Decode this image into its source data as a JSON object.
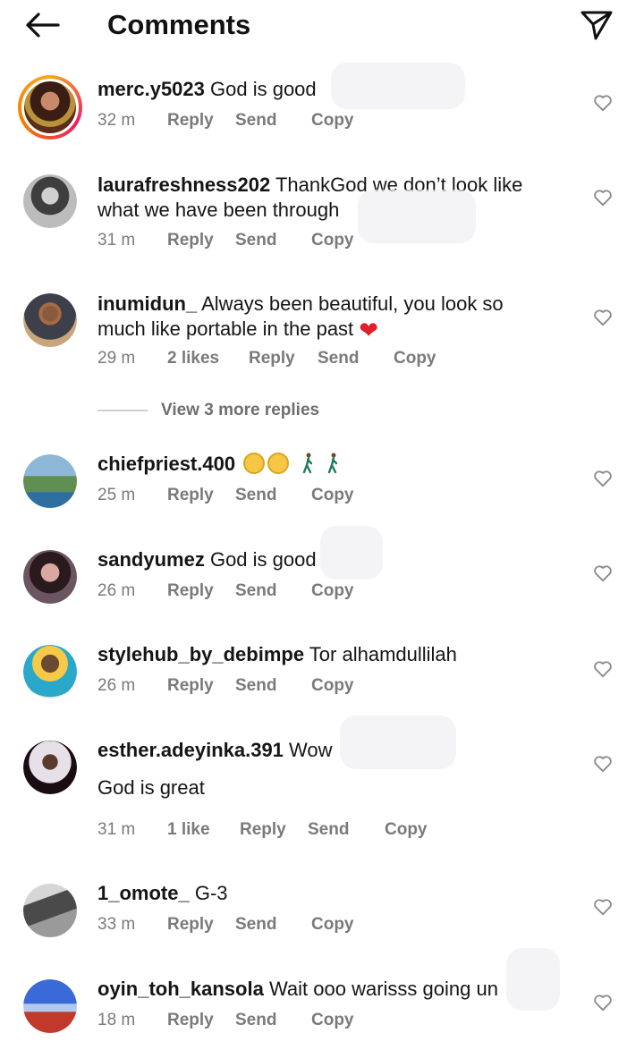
{
  "header": {
    "title": "Comments",
    "back_icon": "arrow-left-icon",
    "send_icon": "paper-plane-icon"
  },
  "colors": {
    "text": "#151515",
    "muted": "#7a7a7a",
    "heart_red": "#e01f2b",
    "story_ring": "#e91e63"
  },
  "actions": {
    "reply": "Reply",
    "send": "Send",
    "copy": "Copy"
  },
  "comments": [
    {
      "username": "merc.y5023",
      "text": "God is good",
      "time": "32 m",
      "likes": ""
    },
    {
      "username": "laurafreshness202",
      "text": "ThankGod we don’t look like what we have been through",
      "time": "31 m",
      "likes": ""
    },
    {
      "username": "inumidun_",
      "text": "Always been beautiful, you look so much like portable in the past",
      "time": "29 m",
      "likes": "2 likes"
    },
    {
      "username": "chiefpriest.400",
      "text": "",
      "time": "25 m",
      "likes": ""
    },
    {
      "username": "sandyumez",
      "text": "God is good",
      "time": "26 m",
      "likes": ""
    },
    {
      "username": "stylehub_by_debimpe",
      "text": "Tor alhamdullilah",
      "time": "26 m",
      "likes": ""
    },
    {
      "username": "esther.adeyinka.391",
      "text": "Wow",
      "text_line2": "God is great",
      "time": "31 m",
      "likes": "1 like"
    },
    {
      "username": "1_omote_",
      "text": "G-3",
      "time": "33 m",
      "likes": ""
    },
    {
      "username": "oyin_toh_kansola",
      "text": "Wait ooo warisss going un",
      "time": "18 m",
      "likes": ""
    }
  ],
  "view_replies": "View 3 more replies"
}
